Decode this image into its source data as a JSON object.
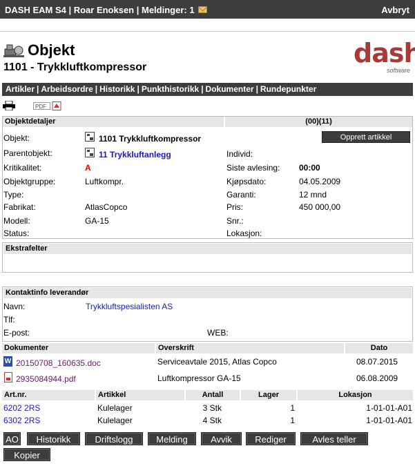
{
  "topbar": {
    "app": "DASH EAM S4 | Roar Enoksen | Meldinger: 1",
    "cancel": "Avbryt"
  },
  "header": {
    "title": "Objekt",
    "subtitle": "1101 - Trykkluftkompressor",
    "logo_text": "dash",
    "logo_sub": "software"
  },
  "nav": [
    "Artikler",
    "Arbeidsordre",
    "Historikk",
    "Punkthistorikk",
    "Dokumenter",
    "Rundepunkter"
  ],
  "toolbar": {
    "pdf_label": "PDF"
  },
  "details": {
    "heading": "Objektdetaljer",
    "counts": "(00)(11)",
    "create_button": "Opprett artikkel",
    "left": [
      {
        "label": "Objekt:",
        "value": "1101 Trykkluftkompressor"
      },
      {
        "label": "Parentobjekt:",
        "value": "11 Trykkluftanlegg"
      },
      {
        "label": "Kritikalitet:",
        "value": "A"
      },
      {
        "label": "Objektgruppe:",
        "value": "Luftkompr."
      },
      {
        "label": "Type:",
        "value": ""
      },
      {
        "label": "Fabrikat:",
        "value": "AtlasCopco"
      },
      {
        "label": "Modell:",
        "value": "GA-15"
      },
      {
        "label": "Status:",
        "value": ""
      }
    ],
    "right": [
      {
        "label": "Individ:",
        "value": ""
      },
      {
        "label": "Siste avlesing:",
        "value": "00:00"
      },
      {
        "label": "Kjøpsdato:",
        "value": "04.05.2009"
      },
      {
        "label": "Garanti:",
        "value": "12 mnd"
      },
      {
        "label": "Pris:",
        "value": "450 000,00"
      },
      {
        "label": "Snr.:",
        "value": ""
      },
      {
        "label": "Lokasjon:",
        "value": ""
      }
    ]
  },
  "extra": {
    "heading": "Ekstrafelter"
  },
  "contact": {
    "heading": "Kontaktinfo leverandør",
    "name_label": "Navn:",
    "name_value": "Trykkluftspesialisten AS",
    "phone_label": "Tlf:",
    "email_label": "E-post:",
    "web_label": "WEB:"
  },
  "documents": {
    "headers": [
      "Dokumenter",
      "Overskrift",
      "Dato"
    ],
    "rows": [
      {
        "file": "20150708_160635.doc",
        "title": "Serviceavtale 2015, Atlas Copco",
        "date": "08.07.2015"
      },
      {
        "file": "2935084944.pdf",
        "title": "Luftkompressor GA-15",
        "date": "06.08.2009"
      }
    ]
  },
  "articles": {
    "headers": [
      "Art.nr.",
      "Artikkel",
      "Antall",
      "Lager",
      "Lokasjon"
    ],
    "rows": [
      {
        "nr": "6202 2RS",
        "name": "Kulelager",
        "qty": "3 Stk",
        "store": "1",
        "loc": "1-01-01-A01"
      },
      {
        "nr": "6302 2RS",
        "name": "Kulelager",
        "qty": "4 Stk",
        "store": "1",
        "loc": "1-01-01-A01"
      }
    ]
  },
  "buttons": [
    "AO",
    "Historikk",
    "Driftslogg",
    "Melding",
    "Avvik",
    "Rediger",
    "Avles teller",
    "Kopier"
  ]
}
